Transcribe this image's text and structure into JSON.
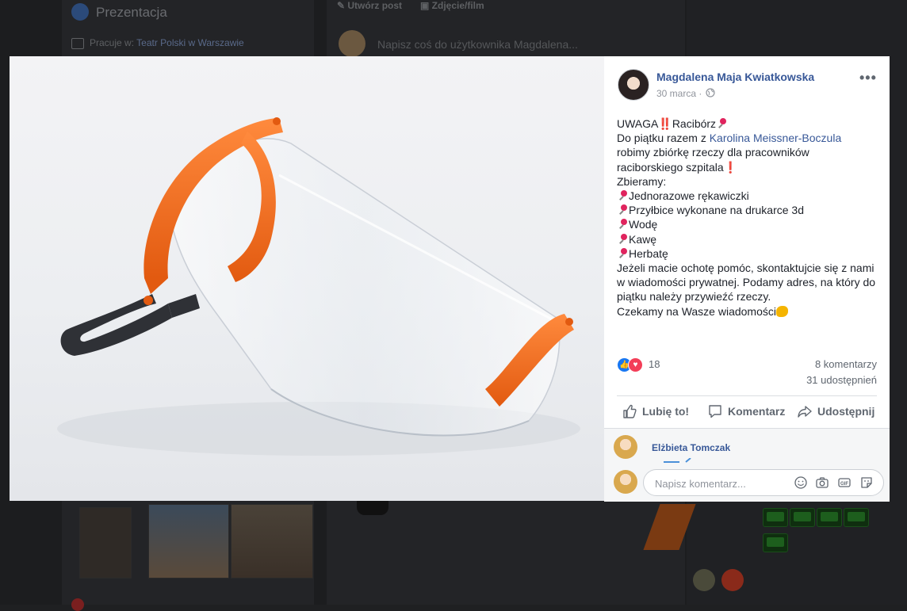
{
  "background": {
    "section_title": "Prezentacja",
    "work_prefix": "Pracuje w: ",
    "work_place": "Teatr Polski w Warszawie",
    "create_post": "Utwórz post",
    "photo_video": "Zdjęcie/film",
    "composer_placeholder": "Napisz coś do użytkownika Magdalena..."
  },
  "post": {
    "author": "Magdalena Maja Kwiatkowska",
    "date": "30 marca",
    "date_separator": "·",
    "more_label": "•••",
    "text": {
      "l1_a": "UWAGA",
      "l1_bang": "‼️",
      "l1_b": "Racibórz",
      "l2_a": "Do piątku razem z ",
      "l2_link": "Karolina Meissner-Boczula",
      "l3": "robimy zbiórkę rzeczy dla pracowników",
      "l4_a": "raciborskiego szpitala",
      "l4_bang": "❗",
      "l5": "Zbieramy:",
      "items": [
        "Jednorazowe rękawiczki",
        "Przyłbice wykonane na drukarce 3d",
        "Wodę",
        "Kawę",
        "Herbatę"
      ],
      "p2": "Jeżeli macie ochotę pomóc, skontaktujcie się z nami w wiadomości prywatnej. Podamy adres, na który do piątku należy przywieźć rzeczy.",
      "p3": "Czekamy na Wasze wiadomości"
    },
    "reaction_count": "18",
    "comments_count": "8 komentarzy",
    "shares_count": "31 udostępnień",
    "actions": {
      "like": "Lubię to!",
      "comment": "Komentarz",
      "share": "Udostępnij"
    },
    "comment_author": "Elżbieta Tomczak",
    "comment_placeholder": "Napisz komentarz...",
    "icons": {
      "like": "thumbs-up-icon",
      "comment": "speech-bubble-icon",
      "share": "share-arrow-icon",
      "emoji": "smiley-icon",
      "camera": "camera-icon",
      "gif": "gif-icon",
      "sticker": "sticker-icon"
    },
    "colors": {
      "link": "#385898",
      "like_blue": "#1877f2",
      "love_red": "#f33e58",
      "visor_orange": "#f26a1b"
    }
  }
}
